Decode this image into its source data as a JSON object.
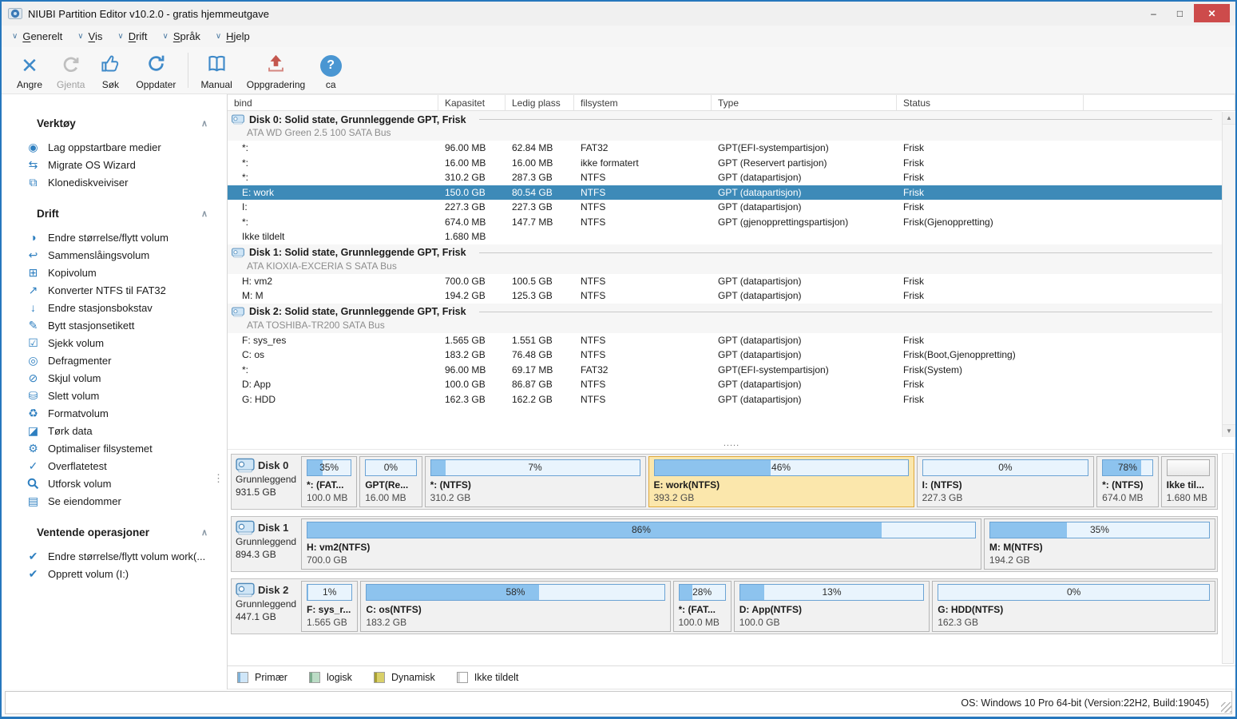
{
  "window": {
    "title": "NIUBI Partition Editor v10.2.0 - gratis hjemmeutgave",
    "controls": {
      "minimize": "–",
      "maximize": "□",
      "close": "✕"
    }
  },
  "menu": {
    "items": [
      {
        "label": "Generelt"
      },
      {
        "label": "Vis"
      },
      {
        "label": "Drift"
      },
      {
        "label": "Språk"
      },
      {
        "label": "Hjelp"
      }
    ]
  },
  "toolbar": {
    "buttons": [
      {
        "id": "undo",
        "label": "Angre",
        "icon": "x-icon",
        "disabled": false
      },
      {
        "id": "redo",
        "label": "Gjenta",
        "icon": "curved-arrow-icon",
        "disabled": true
      },
      {
        "id": "search",
        "label": "Søk",
        "icon": "thumbs-up-icon",
        "disabled": false
      },
      {
        "id": "refresh",
        "label": "Oppdater",
        "icon": "refresh-icon",
        "disabled": false,
        "separator_after": true
      },
      {
        "id": "manual",
        "label": "Manual",
        "icon": "book-icon",
        "disabled": false
      },
      {
        "id": "upgrade",
        "label": "Oppgradering",
        "icon": "upload-arrow-icon",
        "disabled": false
      },
      {
        "id": "about",
        "label": "ca",
        "icon": "question-mark-icon",
        "disabled": false
      }
    ]
  },
  "sidebar": {
    "sections": [
      {
        "title": "Verktøy",
        "items": [
          {
            "label": "Lag oppstartbare medier",
            "icon": "disc-icon"
          },
          {
            "label": "Migrate OS Wizard",
            "icon": "migrate-icon"
          },
          {
            "label": "Klonediskveiviser",
            "icon": "clone-disk-icon"
          }
        ]
      },
      {
        "title": "Drift",
        "items": [
          {
            "label": "Endre størrelse/flytt volum",
            "icon": "resize-pie-icon"
          },
          {
            "label": "Sammenslåingsvolum",
            "icon": "merge-arrow-icon"
          },
          {
            "label": "Kopivolum",
            "icon": "copy-icon"
          },
          {
            "label": "Konverter NTFS til FAT32",
            "icon": "convert-arrow-icon"
          },
          {
            "label": "Endre stasjonsbokstav",
            "icon": "drive-letter-icon"
          },
          {
            "label": "Bytt stasjonsetikett",
            "icon": "rename-pencil-icon"
          },
          {
            "label": "Sjekk volum",
            "icon": "checkbox-icon"
          },
          {
            "label": "Defragmenter",
            "icon": "defrag-icon"
          },
          {
            "label": "Skjul volum",
            "icon": "hide-eye-icon"
          },
          {
            "label": "Slett volum",
            "icon": "delete-volume-icon"
          },
          {
            "label": "Formatvolum",
            "icon": "format-recycle-icon"
          },
          {
            "label": "Tørk data",
            "icon": "wipe-eraser-icon"
          },
          {
            "label": "Optimaliser filsystemet",
            "icon": "gear-icon"
          },
          {
            "label": "Overflatetest",
            "icon": "surface-check-icon"
          },
          {
            "label": "Utforsk volum",
            "icon": "magnifier-icon"
          },
          {
            "label": "Se eiendommer",
            "icon": "properties-doc-icon"
          }
        ]
      },
      {
        "title": "Ventende operasjoner",
        "items": [
          {
            "label": "Endre størrelse/flytt volum work(...",
            "icon": "check-icon"
          },
          {
            "label": "Opprett volum (I:)",
            "icon": "check-icon"
          }
        ]
      }
    ]
  },
  "table": {
    "columns": [
      "bind",
      "Kapasitet",
      "Ledig plass",
      "filsystem",
      "Type",
      "Status",
      ""
    ],
    "groups": [
      {
        "disk_title": "Disk 0: Solid state, Grunnleggende GPT, Frisk",
        "bus": "ATA WD Green 2.5 100 SATA Bus",
        "rows": [
          {
            "bind": "*:",
            "kapasitet": "96.00 MB",
            "ledig": "62.84 MB",
            "fs": "FAT32",
            "type": "GPT(EFI-systempartisjon)",
            "status": "Frisk",
            "selected": false
          },
          {
            "bind": "*:",
            "kapasitet": "16.00 MB",
            "ledig": "16.00 MB",
            "fs": "ikke formatert",
            "type": "GPT (Reservert partisjon)",
            "status": "Frisk",
            "selected": false
          },
          {
            "bind": "*:",
            "kapasitet": "310.2 GB",
            "ledig": "287.3 GB",
            "fs": "NTFS",
            "type": "GPT (datapartisjon)",
            "status": "Frisk",
            "selected": false
          },
          {
            "bind": "E: work",
            "kapasitet": "150.0 GB",
            "ledig": "80.54 GB",
            "fs": "NTFS",
            "type": "GPT (datapartisjon)",
            "status": "Frisk",
            "selected": true
          },
          {
            "bind": "I:",
            "kapasitet": "227.3 GB",
            "ledig": "227.3 GB",
            "fs": "NTFS",
            "type": "GPT (datapartisjon)",
            "status": "Frisk",
            "selected": false
          },
          {
            "bind": "*:",
            "kapasitet": "674.0 MB",
            "ledig": "147.7 MB",
            "fs": "NTFS",
            "type": "GPT (gjenopprettingspartisjon)",
            "status": "Frisk(Gjenoppretting)",
            "selected": false
          },
          {
            "bind": "Ikke tildelt",
            "kapasitet": "1.680 MB",
            "ledig": "",
            "fs": "",
            "type": "",
            "status": "",
            "selected": false
          }
        ]
      },
      {
        "disk_title": "Disk 1: Solid state, Grunnleggende GPT, Frisk",
        "bus": "ATA KIOXIA-EXCERIA S SATA Bus",
        "rows": [
          {
            "bind": "H: vm2",
            "kapasitet": "700.0 GB",
            "ledig": "100.5 GB",
            "fs": "NTFS",
            "type": "GPT (datapartisjon)",
            "status": "Frisk",
            "selected": false
          },
          {
            "bind": "M: M",
            "kapasitet": "194.2 GB",
            "ledig": "125.3 GB",
            "fs": "NTFS",
            "type": "GPT (datapartisjon)",
            "status": "Frisk",
            "selected": false
          }
        ]
      },
      {
        "disk_title": "Disk 2: Solid state, Grunnleggende GPT, Frisk",
        "bus": "ATA TOSHIBA-TR200 SATA Bus",
        "rows": [
          {
            "bind": "F: sys_res",
            "kapasitet": "1.565 GB",
            "ledig": "1.551 GB",
            "fs": "NTFS",
            "type": "GPT (datapartisjon)",
            "status": "Frisk",
            "selected": false
          },
          {
            "bind": "C: os",
            "kapasitet": "183.2 GB",
            "ledig": "76.48 GB",
            "fs": "NTFS",
            "type": "GPT (datapartisjon)",
            "status": "Frisk(Boot,Gjenoppretting)",
            "selected": false
          },
          {
            "bind": "*:",
            "kapasitet": "96.00 MB",
            "ledig": "69.17 MB",
            "fs": "FAT32",
            "type": "GPT(EFI-systempartisjon)",
            "status": "Frisk(System)",
            "selected": false
          },
          {
            "bind": "D: App",
            "kapasitet": "100.0 GB",
            "ledig": "86.87 GB",
            "fs": "NTFS",
            "type": "GPT (datapartisjon)",
            "status": "Frisk",
            "selected": false
          },
          {
            "bind": "G: HDD",
            "kapasitet": "162.3 GB",
            "ledig": "162.2 GB",
            "fs": "NTFS",
            "type": "GPT (datapartisjon)",
            "status": "Frisk",
            "selected": false
          }
        ]
      }
    ]
  },
  "disk_panels": [
    {
      "name": "Disk 0",
      "type_label": "Grunnleggend",
      "size": "931.5 GB",
      "blocks": [
        {
          "label": "*: (FAT...",
          "size": "100.0 MB",
          "percent": "35%",
          "fill": 35,
          "width_ratio": 62,
          "selected": false,
          "unallocated": false
        },
        {
          "label": "GPT(Re...",
          "size": "16.00 MB",
          "percent": "0%",
          "fill": 0,
          "width_ratio": 71,
          "selected": false,
          "unallocated": false
        },
        {
          "label": "*: (NTFS)",
          "size": "310.2 GB",
          "percent": "7%",
          "fill": 7,
          "width_ratio": 290,
          "selected": false,
          "unallocated": false
        },
        {
          "label": "E: work(NTFS)",
          "size": "393.2 GB",
          "percent": "46%",
          "fill": 46,
          "width_ratio": 352,
          "selected": true,
          "unallocated": false
        },
        {
          "label": "I: (NTFS)",
          "size": "227.3 GB",
          "percent": "0%",
          "fill": 0,
          "width_ratio": 230,
          "selected": false,
          "unallocated": false
        },
        {
          "label": "*: (NTFS)",
          "size": "674.0 MB",
          "percent": "78%",
          "fill": 78,
          "width_ratio": 70,
          "selected": false,
          "unallocated": false
        },
        {
          "label": "Ikke til...",
          "size": "1.680 MB",
          "percent": "",
          "fill": 0,
          "width_ratio": 60,
          "selected": false,
          "unallocated": true
        }
      ]
    },
    {
      "name": "Disk 1",
      "type_label": "Grunnleggend",
      "size": "894.3 GB",
      "blocks": [
        {
          "label": "H: vm2(NTFS)",
          "size": "700.0 GB",
          "percent": "86%",
          "fill": 86,
          "width_ratio": 865,
          "selected": false,
          "unallocated": false
        },
        {
          "label": "M: M(NTFS)",
          "size": "194.2 GB",
          "percent": "35%",
          "fill": 35,
          "width_ratio": 285,
          "selected": false,
          "unallocated": false
        }
      ]
    },
    {
      "name": "Disk 2",
      "type_label": "Grunnleggend",
      "size": "447.1 GB",
      "blocks": [
        {
          "label": "F: sys_r...",
          "size": "1.565 GB",
          "percent": "1%",
          "fill": 1,
          "width_ratio": 62,
          "selected": false,
          "unallocated": false
        },
        {
          "label": "C: os(NTFS)",
          "size": "183.2 GB",
          "percent": "58%",
          "fill": 58,
          "width_ratio": 404,
          "selected": false,
          "unallocated": false
        },
        {
          "label": "*: (FAT...",
          "size": "100.0 MB",
          "percent": "28%",
          "fill": 28,
          "width_ratio": 64,
          "selected": false,
          "unallocated": false
        },
        {
          "label": "D: App(NTFS)",
          "size": "100.0 GB",
          "percent": "13%",
          "fill": 13,
          "width_ratio": 250,
          "selected": false,
          "unallocated": false
        },
        {
          "label": "G: HDD(NTFS)",
          "size": "162.3 GB",
          "percent": "0%",
          "fill": 0,
          "width_ratio": 368,
          "selected": false,
          "unallocated": false
        }
      ]
    }
  ],
  "legend": [
    {
      "label": "Primær",
      "fill": "#cfe6f8",
      "edge": "#7fb2d9"
    },
    {
      "label": "logisk",
      "fill": "#bcdcc6",
      "edge": "#7cad8e"
    },
    {
      "label": "Dynamisk",
      "fill": "#d9d069",
      "edge": "#a89f33"
    },
    {
      "label": "Ikke tildelt",
      "fill": "#ffffff",
      "edge": "#d9d9d9"
    }
  ],
  "statusbar": {
    "os_info": "OS: Windows 10 Pro 64-bit (Version:22H2, Build:19045)"
  },
  "misc": {
    "pane_splitter_dots": ".....",
    "sidebar_splitter_dots": "⋮"
  }
}
